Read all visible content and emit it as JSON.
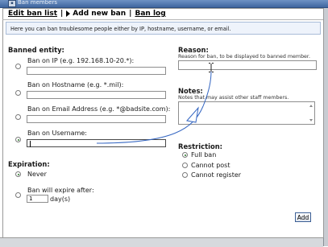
{
  "window": {
    "title": "Ban members",
    "title_icon": "app-icon"
  },
  "nav": {
    "edit_ban_list": "Edit ban list",
    "separator": "|",
    "add_new_ban": "Add new ban",
    "ban_log": "Ban log"
  },
  "info_text": "Here you can ban troublesome people either by IP, hostname, username, or email.",
  "banned_entity": {
    "heading": "Banned entity:",
    "options": [
      {
        "label": "Ban on IP (e.g. 192.168.10-20.*):",
        "value": "",
        "selected": false
      },
      {
        "label": "Ban on Hostname (e.g. *.mil):",
        "value": "",
        "selected": false
      },
      {
        "label": "Ban on Email Address (e.g. *@badsite.com):",
        "value": "",
        "selected": false
      },
      {
        "label": "Ban on Username:",
        "value": "",
        "selected": true
      }
    ]
  },
  "reason": {
    "heading": "Reason:",
    "hint": "Reason for ban, to be displayed to banned member.",
    "value": ""
  },
  "notes": {
    "heading": "Notes:",
    "hint": "Notes that may assist other staff members.",
    "value": ""
  },
  "restriction": {
    "heading": "Restriction:",
    "options": [
      {
        "label": "Full ban",
        "selected": true
      },
      {
        "label": "Cannot post",
        "selected": false
      },
      {
        "label": "Cannot register",
        "selected": false
      }
    ]
  },
  "expiration": {
    "heading": "Expiration:",
    "never_label": "Never",
    "never_selected": true,
    "expire_label": "Ban will expire after:",
    "days_value": "1",
    "days_unit": "day(s)"
  },
  "actions": {
    "add_label": "Add"
  },
  "colors": {
    "titlebar": "#4a72ad",
    "info_bg": "#eef3fb",
    "radio_selected": "#2c7a2c",
    "annotation_arrow": "#3466c2"
  }
}
